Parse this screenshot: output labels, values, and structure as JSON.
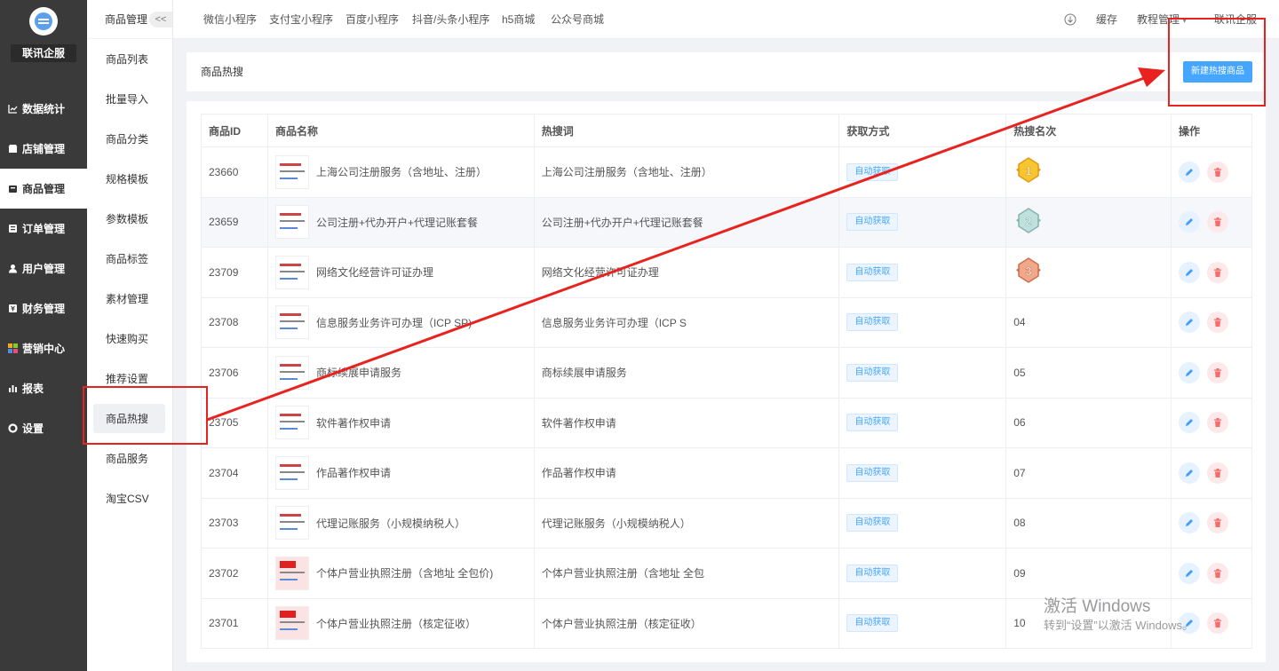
{
  "brand": {
    "name": "联讯企服"
  },
  "main_menu": [
    {
      "label": "数据统计",
      "icon": "chart-icon"
    },
    {
      "label": "店铺管理",
      "icon": "store-icon"
    },
    {
      "label": "商品管理",
      "icon": "goods-icon"
    },
    {
      "label": "订单管理",
      "icon": "order-icon"
    },
    {
      "label": "用户管理",
      "icon": "user-icon"
    },
    {
      "label": "财务管理",
      "icon": "finance-icon"
    },
    {
      "label": "营销中心",
      "icon": "marketing-icon"
    },
    {
      "label": "报表",
      "icon": "report-icon"
    },
    {
      "label": "设置",
      "icon": "gear-icon"
    }
  ],
  "sub_menu": {
    "title": "商品管理",
    "collapse": "<<",
    "items": [
      "商品列表",
      "批量导入",
      "商品分类",
      "规格模板",
      "参数模板",
      "商品标签",
      "素材管理",
      "快速购买",
      "推荐设置",
      "商品热搜",
      "商品服务",
      "淘宝CSV"
    ]
  },
  "top_nav": {
    "tabs": [
      "微信小程序",
      "支付宝小程序",
      "百度小程序",
      "抖音/头条小程序",
      "h5商城",
      "公众号商城"
    ],
    "cache": "缓存",
    "tutorial": "教程管理",
    "account": "联讯企服"
  },
  "header": {
    "title": "商品热搜",
    "new_button": "新建热搜商品"
  },
  "table": {
    "columns": [
      "商品ID",
      "商品名称",
      "热搜词",
      "获取方式",
      "热搜名次",
      "操作"
    ],
    "rows": [
      {
        "id": "23660",
        "name": "上海公司注册服务（含地址、注册）",
        "keyword": "上海公司注册服务（含地址、注册）",
        "method": "自动获取",
        "rank": "1",
        "medal": "gold"
      },
      {
        "id": "23659",
        "name": "公司注册+代办开户+代理记账套餐",
        "keyword": "公司注册+代办开户+代理记账套餐",
        "method": "自动获取",
        "rank": "2",
        "medal": "silver"
      },
      {
        "id": "23709",
        "name": "网络文化经营许可证办理",
        "keyword": "网络文化经营许可证办理",
        "method": "自动获取",
        "rank": "3",
        "medal": "bronze"
      },
      {
        "id": "23708",
        "name": "信息服务业务许可办理（ICP SP)",
        "keyword": "信息服务业务许可办理（ICP S",
        "method": "自动获取",
        "rank": "04",
        "medal": ""
      },
      {
        "id": "23706",
        "name": "商标续展申请服务",
        "keyword": "商标续展申请服务",
        "method": "自动获取",
        "rank": "05",
        "medal": ""
      },
      {
        "id": "23705",
        "name": "软件著作权申请",
        "keyword": "软件著作权申请",
        "method": "自动获取",
        "rank": "06",
        "medal": ""
      },
      {
        "id": "23704",
        "name": "作品著作权申请",
        "keyword": "作品著作权申请",
        "method": "自动获取",
        "rank": "07",
        "medal": ""
      },
      {
        "id": "23703",
        "name": "代理记账服务（小规模纳税人）",
        "keyword": "代理记账服务（小规模纳税人）",
        "method": "自动获取",
        "rank": "08",
        "medal": ""
      },
      {
        "id": "23702",
        "name": "个体户营业执照注册（含地址 全包价)",
        "keyword": "个体户营业执照注册（含地址 全包",
        "method": "自动获取",
        "rank": "09",
        "medal": ""
      },
      {
        "id": "23701",
        "name": "个体户营业执照注册（核定征收）",
        "keyword": "个体户营业执照注册（核定征收）",
        "method": "自动获取",
        "rank": "10",
        "medal": ""
      }
    ]
  },
  "watermark": {
    "line1": "激活 Windows",
    "line2": "转到“设置”以激活 Windows。"
  },
  "colors": {
    "sidebar": "#3a3a3a",
    "accent": "#45a6ff",
    "annotation": "#e8231f",
    "delete": "#f56c6c"
  }
}
